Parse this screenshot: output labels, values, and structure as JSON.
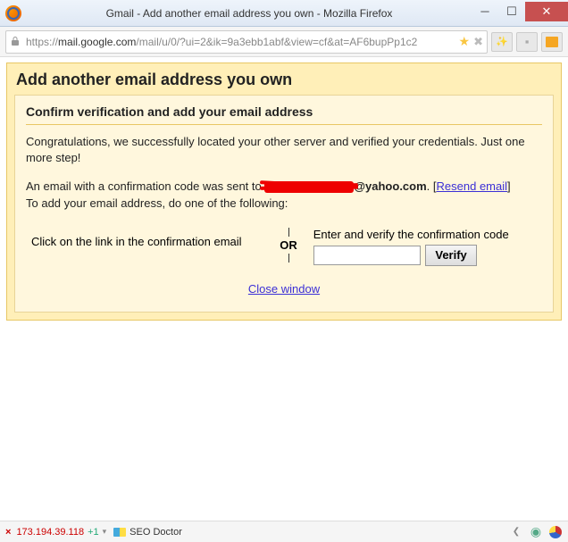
{
  "window": {
    "title": "Gmail - Add another email address you own - Mozilla Firefox"
  },
  "urlbar": {
    "scheme": "https://",
    "domain": "mail.google.com",
    "path": "/mail/u/0/?ui=2&ik=9a3ebb1abf&view=cf&at=AF6bupPp1c2"
  },
  "panel": {
    "title": "Add another email address you own",
    "subtitle": "Confirm verification and add your email address",
    "congrats": "Congratulations, we successfully located your other server and verified your credentials. Just one more step!",
    "sent_prefix": "An email with a confirmation code was sent to ",
    "email_suffix": "@yahoo.com",
    "period": ". ",
    "resend_open": "[",
    "resend_label": "Resend email",
    "resend_close": "]",
    "add_line": "To add your email address, do one of the following:",
    "left_option": "Click on the link in the confirmation email",
    "or": "OR",
    "right_label": "Enter and verify the confirmation code",
    "verify_button": "Verify",
    "close_link": "Close window"
  },
  "status": {
    "ip": "173.194.39.118",
    "plus": "+1",
    "seo": "SEO Doctor"
  }
}
